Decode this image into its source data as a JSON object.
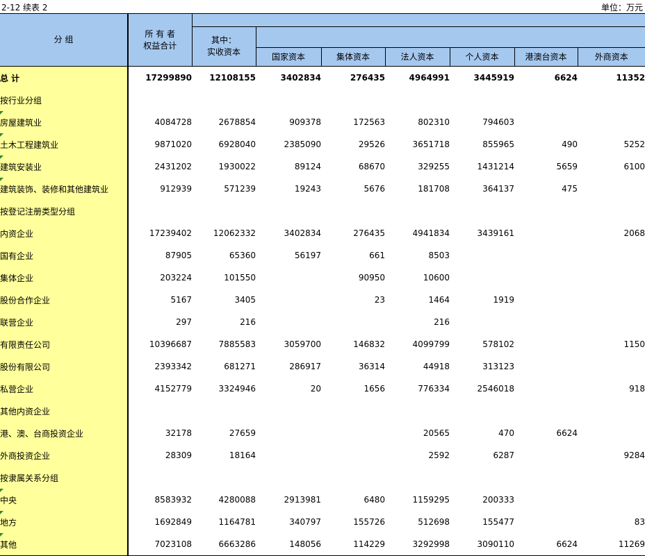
{
  "header": {
    "table_number": "2-12  续表 2",
    "unit": "单位：万元"
  },
  "columns": {
    "group": "分  组",
    "equity_line1": "所 有 者",
    "equity_line2": "权益合计",
    "paid_in_line1": "其中：",
    "paid_in_line2": "实收资本",
    "state": "国家资本",
    "collective": "集体资本",
    "legal": "法人资本",
    "individual": "个人资本",
    "hkmt": "港澳台资本",
    "foreign": "外商资本"
  },
  "rows": [
    {
      "label": "总  计",
      "values": [
        "17299890",
        "12108155",
        "3402834",
        "276435",
        "4964991",
        "3445919",
        "6624",
        "11352"
      ]
    },
    {
      "label": "按行业分组",
      "values": [
        "",
        "",
        "",
        "",
        "",
        "",
        "",
        ""
      ]
    },
    {
      "label": "房屋建筑业",
      "values": [
        "4084728",
        "2678854",
        "909378",
        "172563",
        "802310",
        "794603",
        "",
        ""
      ]
    },
    {
      "label": "土木工程建筑业",
      "values": [
        "9871020",
        "6928040",
        "2385090",
        "29526",
        "3651718",
        "855965",
        "490",
        "5252"
      ]
    },
    {
      "label": "建筑安装业",
      "values": [
        "2431202",
        "1930022",
        "89124",
        "68670",
        "329255",
        "1431214",
        "5659",
        "6100"
      ]
    },
    {
      "label": "建筑装饰、装修和其他建筑业",
      "values": [
        "912939",
        "571239",
        "19243",
        "5676",
        "181708",
        "364137",
        "475",
        ""
      ]
    },
    {
      "label": "按登记注册类型分组",
      "values": [
        "",
        "",
        "",
        "",
        "",
        "",
        "",
        ""
      ]
    },
    {
      "label": "内资企业",
      "values": [
        "17239402",
        "12062332",
        "3402834",
        "276435",
        "4941834",
        "3439161",
        "",
        "2068"
      ]
    },
    {
      "label": "国有企业",
      "values": [
        "87905",
        "65360",
        "56197",
        "661",
        "8503",
        "",
        "",
        ""
      ]
    },
    {
      "label": "集体企业",
      "values": [
        "203224",
        "101550",
        "",
        "90950",
        "10600",
        "",
        "",
        ""
      ]
    },
    {
      "label": "股份合作企业",
      "values": [
        "5167",
        "3405",
        "",
        "23",
        "1464",
        "1919",
        "",
        ""
      ]
    },
    {
      "label": "联营企业",
      "values": [
        "297",
        "216",
        "",
        "",
        "216",
        "",
        "",
        ""
      ]
    },
    {
      "label": "有限责任公司",
      "values": [
        "10396687",
        "7885583",
        "3059700",
        "146832",
        "4099799",
        "578102",
        "",
        "1150"
      ]
    },
    {
      "label": "股份有限公司",
      "values": [
        "2393342",
        "681271",
        "286917",
        "36314",
        "44918",
        "313123",
        "",
        ""
      ]
    },
    {
      "label": "私营企业",
      "values": [
        "4152779",
        "3324946",
        "20",
        "1656",
        "776334",
        "2546018",
        "",
        "918"
      ]
    },
    {
      "label": "其他内资企业",
      "values": [
        "",
        "",
        "",
        "",
        "",
        "",
        "",
        ""
      ]
    },
    {
      "label": "港、澳、台商投资企业",
      "values": [
        "32178",
        "27659",
        "",
        "",
        "20565",
        "470",
        "6624",
        ""
      ]
    },
    {
      "label": "外商投资企业",
      "values": [
        "28309",
        "18164",
        "",
        "",
        "2592",
        "6287",
        "",
        "9284"
      ]
    },
    {
      "label": "按隶属关系分组",
      "values": [
        "",
        "",
        "",
        "",
        "",
        "",
        "",
        ""
      ]
    },
    {
      "label": "中央",
      "values": [
        "8583932",
        "4280088",
        "2913981",
        "6480",
        "1159295",
        "200333",
        "",
        ""
      ]
    },
    {
      "label": "地方",
      "values": [
        "1692849",
        "1164781",
        "340797",
        "155726",
        "512698",
        "155477",
        "",
        "83"
      ]
    },
    {
      "label": "其他",
      "values": [
        "7023108",
        "6663286",
        "148056",
        "114229",
        "3292998",
        "3090110",
        "6624",
        "11269"
      ]
    }
  ]
}
